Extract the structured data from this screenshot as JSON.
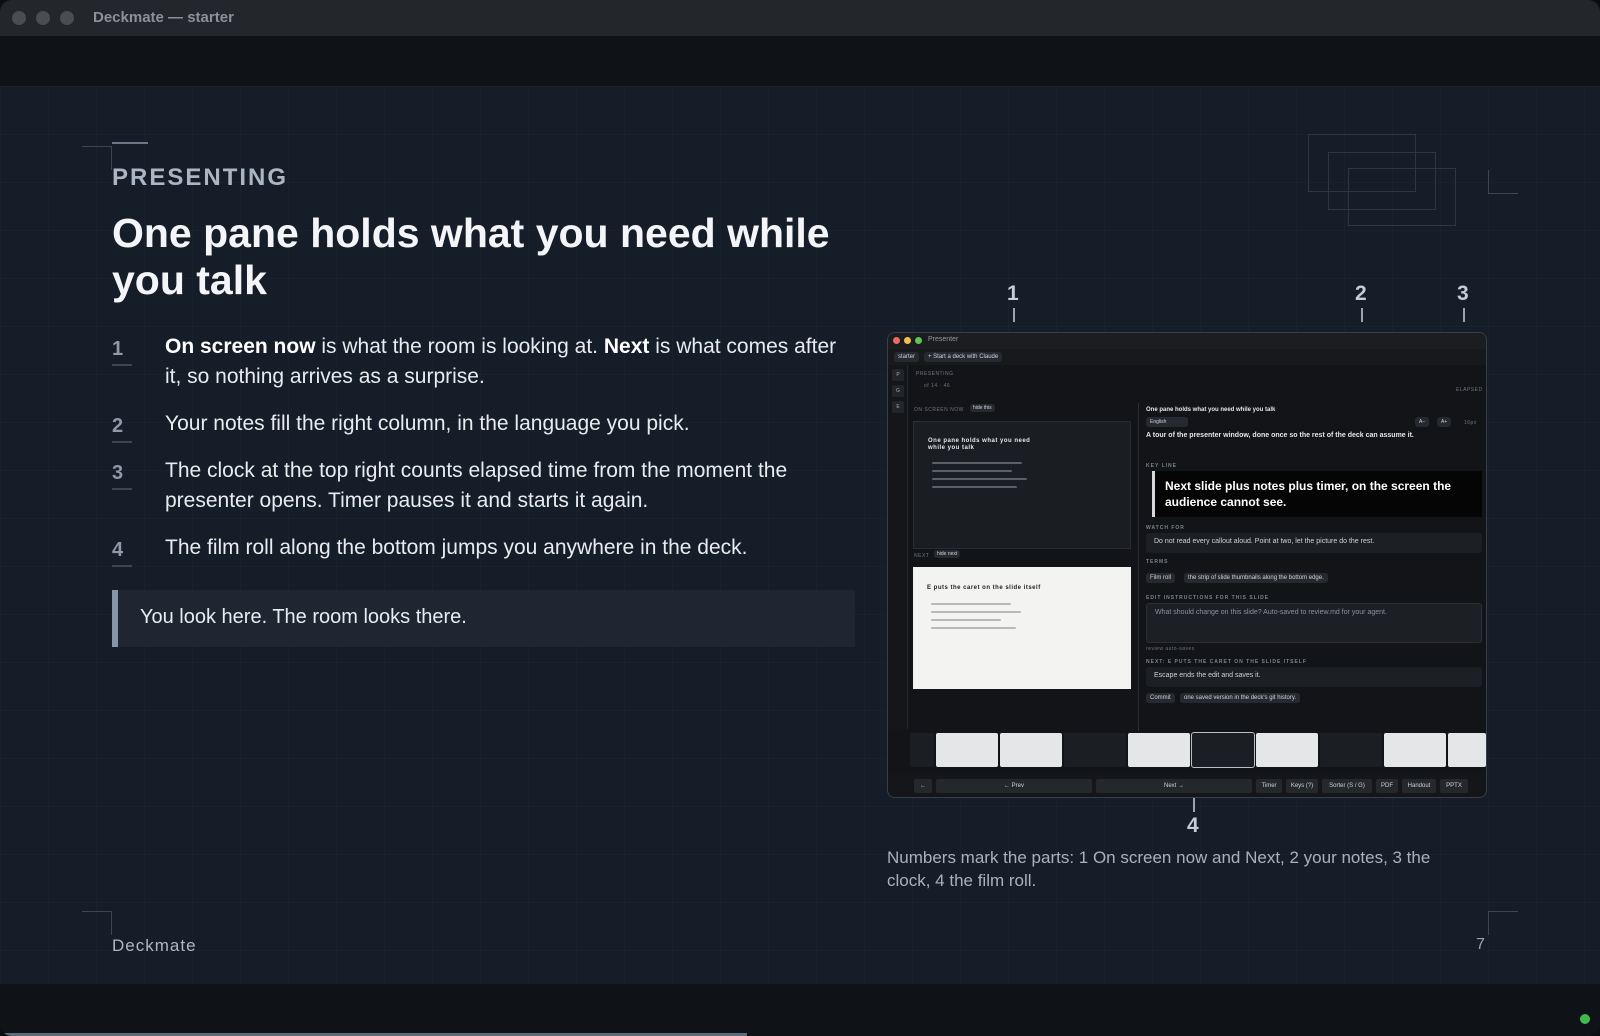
{
  "window": {
    "title": "Deckmate — starter"
  },
  "slide": {
    "eyebrow": "PRESENTING",
    "headline": "One pane holds what you need while you talk",
    "points": [
      {
        "num": "1",
        "bold1": "On screen now",
        "text1": " is what the room is looking at. ",
        "bold2": "Next",
        "text2": " is what comes after it, so nothing arrives as a surprise."
      },
      {
        "num": "2",
        "text": "Your notes fill the right column, in the language you pick."
      },
      {
        "num": "3",
        "text": "The clock at the top right counts elapsed time from the moment the presenter opens. Timer pauses it and starts it again."
      },
      {
        "num": "4",
        "text": "The film roll along the bottom jumps you anywhere in the deck."
      }
    ],
    "quote": "You look here. The room looks there.",
    "callouts": [
      "1",
      "2",
      "3",
      "4"
    ],
    "caption": "Numbers mark the parts: 1 On screen now and Next, 2 your notes, 3 the clock, 4 the film roll.",
    "footer_brand": "Deckmate",
    "page_number": "7"
  },
  "presenter": {
    "window_title": "Presenter",
    "toolbar": {
      "deck": "starter",
      "new_deck": "+ Start a deck with Claude"
    },
    "sidebar_buttons": [
      "P",
      "G",
      "E"
    ],
    "section_label": "PRESENTING",
    "slide_counter": "of 14 · 46",
    "elapsed_label": "ELAPSED",
    "on_screen_label": "ON SCREEN NOW",
    "hide_this": "hide this",
    "next_label": "NEXT",
    "hide_next": "hide next",
    "current_slide_title": "One pane holds what you need while you talk",
    "next_slide_title": "E puts the caret on the slide itself",
    "notes": {
      "slide_title": "One pane holds what you need while you talk",
      "language": "English",
      "font_down": "A−",
      "font_up": "A+",
      "font_size": "16px",
      "intro": "A tour of the presenter window, done once so the rest of the deck can assume it.",
      "key_line_label": "KEY LINE",
      "key_line": "Next slide plus notes plus timer, on the screen the audience cannot see.",
      "watch_for_label": "WATCH FOR",
      "watch_for": "Do not read every callout aloud. Point at two, let the picture do the rest.",
      "terms_label": "TERMS",
      "term": "Film roll",
      "term_def": "the strip of slide thumbnails along the bottom edge.",
      "edit_label": "EDIT INSTRUCTIONS FOR THIS SLIDE",
      "edit_placeholder": "What should change on this slide? Auto-saved to review.md for your agent.",
      "review_note": "review auto-saves",
      "next_notes_label": "NEXT: E PUTS THE CARET ON THE SLIDE ITSELF",
      "next_notes": "Escape ends the edit and saves it.",
      "commit": "Commit",
      "commit_def": "one saved version in the deck's git history."
    },
    "controls": [
      "←",
      "← Prev",
      "Next →",
      "Timer",
      "Keys (?)",
      "Sorter (S / G)",
      "PDF",
      "Handout",
      "PPTX"
    ]
  },
  "colors": {
    "slide_bg": "#151d28",
    "accent": "#8796a6",
    "status": "#3fb950"
  }
}
